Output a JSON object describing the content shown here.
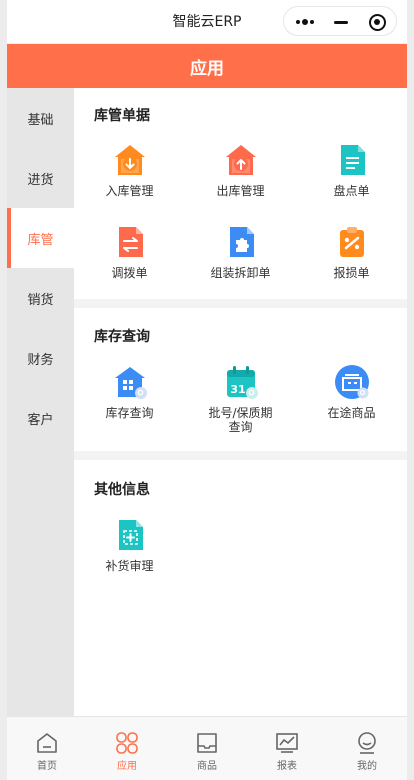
{
  "app_title": "智能云ERP",
  "header_title": "应用",
  "colors": {
    "accent": "#ff6f4a",
    "orange_icon": "#ff8a1e",
    "red_icon": "#ff6a4d",
    "teal_icon": "#1cc4c4",
    "blue_icon": "#3b8cf5"
  },
  "sidebar": {
    "items": [
      {
        "label": "基础"
      },
      {
        "label": "进货"
      },
      {
        "label": "库管",
        "active": true
      },
      {
        "label": "销货"
      },
      {
        "label": "财务"
      },
      {
        "label": "客户"
      }
    ]
  },
  "sections": [
    {
      "title": "库管单据",
      "items": [
        {
          "label": "入库管理",
          "icon": "inbound-house-icon"
        },
        {
          "label": "出库管理",
          "icon": "outbound-house-icon"
        },
        {
          "label": "盘点单",
          "icon": "document-icon"
        },
        {
          "label": "调拨单",
          "icon": "transfer-document-icon"
        },
        {
          "label": "组装拆卸单",
          "icon": "puzzle-document-icon"
        },
        {
          "label": "报损单",
          "icon": "damage-report-icon"
        }
      ]
    },
    {
      "title": "库存查询",
      "items": [
        {
          "label": "库存查询",
          "icon": "warehouse-search-icon"
        },
        {
          "label": "批号/保质期",
          "label2": "查询",
          "icon": "calendar-search-icon"
        },
        {
          "label": "在途商品",
          "icon": "in-transit-icon"
        }
      ]
    },
    {
      "title": "其他信息",
      "items": [
        {
          "label": "补货审理",
          "icon": "restock-document-icon"
        }
      ]
    }
  ],
  "tabbar": {
    "items": [
      {
        "label": "首页",
        "icon": "home-icon"
      },
      {
        "label": "应用",
        "icon": "apps-icon",
        "active": true
      },
      {
        "label": "商品",
        "icon": "goods-icon"
      },
      {
        "label": "报表",
        "icon": "report-chart-icon"
      },
      {
        "label": "我的",
        "icon": "profile-icon"
      }
    ]
  }
}
